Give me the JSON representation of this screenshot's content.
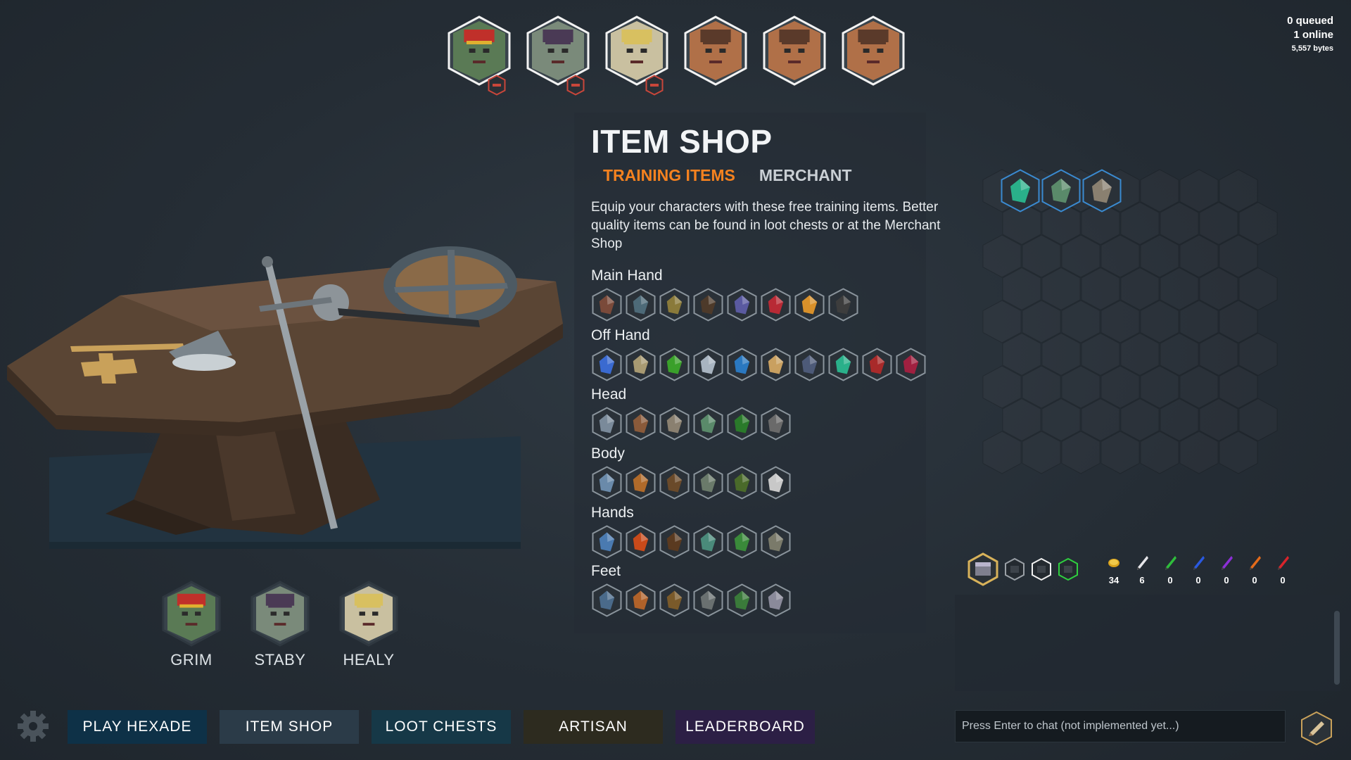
{
  "party": {
    "slots": [
      {
        "icon": "grim-portrait-icon",
        "removable": true
      },
      {
        "icon": "staby-portrait-icon",
        "removable": true
      },
      {
        "icon": "healy-portrait-icon",
        "removable": true
      },
      {
        "icon": "empty-slot-portrait-icon",
        "removable": false
      },
      {
        "icon": "empty-slot-portrait-icon",
        "removable": false
      },
      {
        "icon": "empty-slot-portrait-icon",
        "removable": false
      }
    ]
  },
  "network": {
    "queued": "0 queued",
    "online": "1 online",
    "bytes": "5,557 bytes"
  },
  "shop": {
    "title": "ITEM SHOP",
    "tabs": [
      {
        "label": "TRAINING ITEMS",
        "active": true
      },
      {
        "label": "MERCHANT",
        "active": false
      }
    ],
    "description": "Equip your characters with these free training items. Better quality items can be found in loot chests or at the Merchant Shop",
    "categories": [
      {
        "label": "Main Hand",
        "items": [
          "axe-icon",
          "hatchet-icon",
          "spear-icon",
          "bow-icon",
          "dagger-icon",
          "spellbook-icon",
          "scepter-icon",
          "mace-icon"
        ]
      },
      {
        "label": "Off Hand",
        "items": [
          "round-shield-icon",
          "scroll-icon",
          "green-orb-icon",
          "crystal-icon",
          "vortex-icon",
          "skull-icon",
          "bomb-icon",
          "emerald-icon",
          "red-blade-icon",
          "potion-icon"
        ]
      },
      {
        "label": "Head",
        "items": [
          "hat-icon",
          "leather-cap-icon",
          "spartan-helm-icon",
          "gem-helm-icon",
          "hood-icon",
          "knight-helm-icon"
        ]
      },
      {
        "label": "Body",
        "items": [
          "cloth-robe-icon",
          "leather-vest-icon",
          "studded-armor-icon",
          "chainmail-icon",
          "leaf-armor-icon",
          "plate-armor-icon"
        ]
      },
      {
        "label": "Hands",
        "items": [
          "cloth-gloves-icon",
          "fire-gloves-icon",
          "leather-gloves-icon",
          "gem-gauntlets-icon",
          "nature-gloves-icon",
          "plate-gauntlets-icon"
        ]
      },
      {
        "label": "Feet",
        "items": [
          "cloth-boots-icon",
          "leather-boots-icon",
          "studded-boots-icon",
          "chain-boots-icon",
          "nature-boots-icon",
          "plate-boots-icon"
        ]
      }
    ]
  },
  "equipped": [
    "emerald-icon",
    "gem-helm-icon",
    "spartan-helm-icon"
  ],
  "chests": [
    "loot-chest-icon",
    "common-chest-icon",
    "rare-chest-icon",
    "emerald-chest-icon"
  ],
  "currencies": [
    {
      "icon": "gold-coin-icon",
      "value": "34",
      "color": "#d9a21b"
    },
    {
      "icon": "white-quill-icon",
      "value": "6",
      "color": "#e6e6ea"
    },
    {
      "icon": "green-quill-icon",
      "value": "0",
      "color": "#2fbd3c"
    },
    {
      "icon": "blue-quill-icon",
      "value": "0",
      "color": "#2a59e0"
    },
    {
      "icon": "purple-quill-icon",
      "value": "0",
      "color": "#8b2fd6"
    },
    {
      "icon": "orange-quill-icon",
      "value": "0",
      "color": "#e36b1b"
    },
    {
      "icon": "red-quill-icon",
      "value": "0",
      "color": "#d8242b"
    }
  ],
  "roster": [
    {
      "name": "GRIM",
      "icon": "grim-portrait-icon"
    },
    {
      "name": "STABY",
      "icon": "staby-portrait-icon"
    },
    {
      "name": "HEALY",
      "icon": "healy-portrait-icon"
    }
  ],
  "nav": {
    "play": "PLAY HEXADE",
    "item_shop": "ITEM SHOP",
    "loot_chests": "LOOT CHESTS",
    "artisan": "ARTISAN",
    "leaderboard": "LEADERBOARD"
  },
  "chat": {
    "placeholder": "Press Enter to chat (not implemented yet...)"
  },
  "colors": {
    "accent": "#f5821f",
    "play": "#0e3147",
    "item_shop": "#2b3b48",
    "loot_chests": "#163847",
    "artisan": "#2d2b1f",
    "leaderboard": "#2c1f45"
  }
}
